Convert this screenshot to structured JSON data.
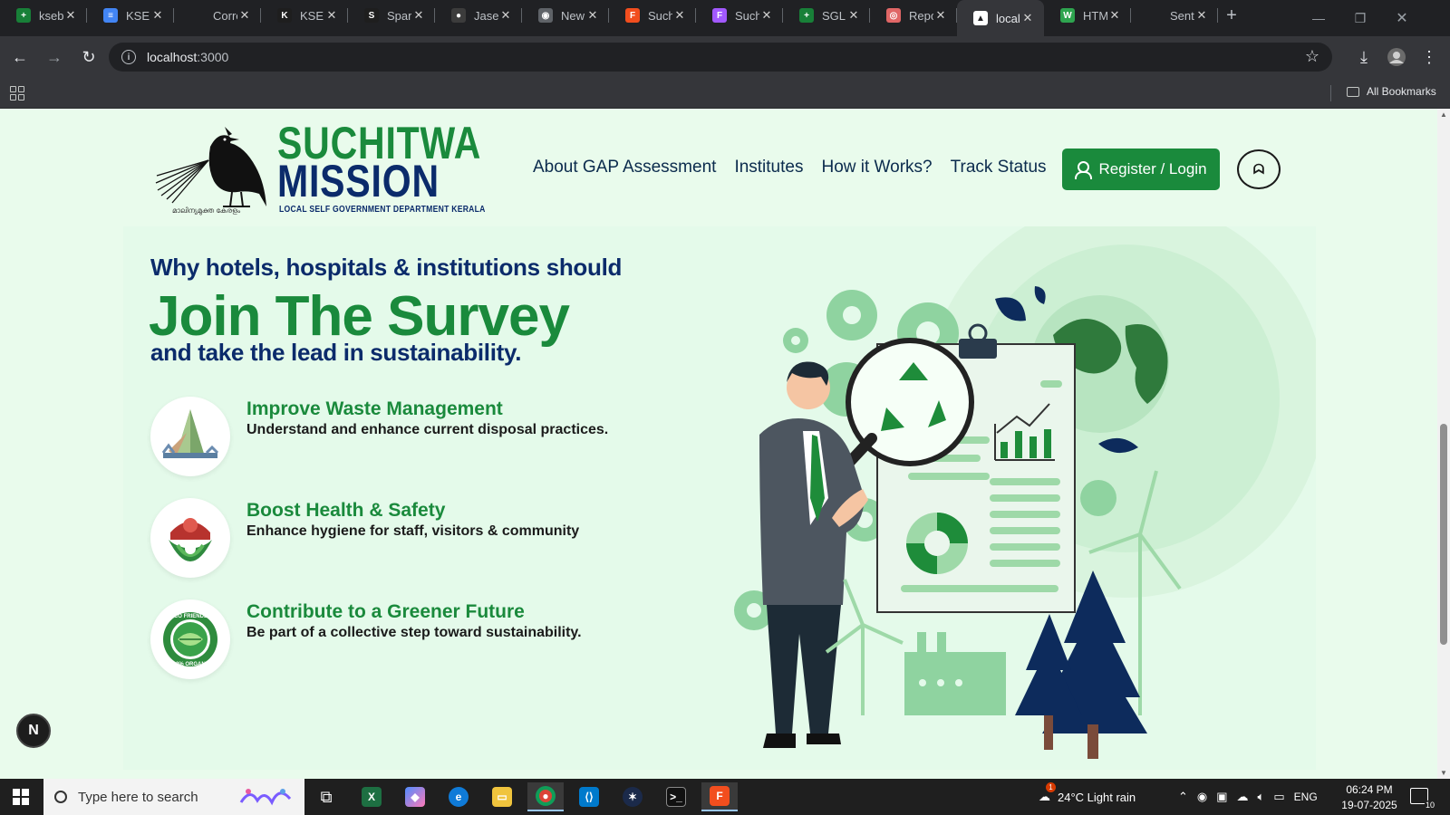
{
  "browser": {
    "tabs": [
      {
        "title": "kseb",
        "color": "#188038",
        "glyph": "+"
      },
      {
        "title": "KSEB",
        "color": "#4285f4",
        "glyph": "≡"
      },
      {
        "title": "Corre",
        "color": "",
        "glyph": ""
      },
      {
        "title": "KSEB",
        "color": "#1e1e1e",
        "glyph": "K"
      },
      {
        "title": "Spare",
        "color": "#1e1e1e",
        "glyph": "S"
      },
      {
        "title": "Jasee",
        "color": "#3c3c3c",
        "glyph": "●"
      },
      {
        "title": "New",
        "color": "#5f6368",
        "glyph": "◉"
      },
      {
        "title": "Such",
        "color": "#f24e1e",
        "glyph": "F"
      },
      {
        "title": "Such",
        "color": "#a259ff",
        "glyph": "F"
      },
      {
        "title": "SGLR",
        "color": "#188038",
        "glyph": "+"
      },
      {
        "title": "Repo",
        "color": "#e06666",
        "glyph": "◎"
      },
      {
        "title": "local",
        "color": "#ffffff",
        "glyph": "▲",
        "active": true
      },
      {
        "title": "HTM",
        "color": "#2ea44f",
        "glyph": "W"
      },
      {
        "title": "Sent",
        "color": "",
        "glyph": ""
      }
    ],
    "url_host": "localhost",
    "url_port": ":3000",
    "all_bookmarks": "All Bookmarks"
  },
  "site": {
    "logo": {
      "line1": "SUCHITWA",
      "line2": "MISSION",
      "subtitle": "LOCAL SELF GOVERNMENT DEPARTMENT KERALA",
      "malayalam": "മാലിന്യമുക്ത കേരളം"
    },
    "nav": [
      "About GAP Assessment",
      "Institutes",
      "How it Works?",
      "Track Status"
    ],
    "register_label": "Register / Login",
    "circle_btn": "ᗣ"
  },
  "hero": {
    "pre": "Why hotels, hospitals & institutions should",
    "main": "Join The Survey",
    "post": "and take the lead in sustainability.",
    "features": [
      {
        "title": "Improve Waste Management",
        "desc": "Understand and enhance current disposal practices."
      },
      {
        "title": "Boost Health & Safety",
        "desc": "Enhance hygiene for staff, visitors & community"
      },
      {
        "title": "Contribute to a Greener Future",
        "desc": "Be part of a collective step toward sustainability."
      }
    ],
    "eco_badge_top": "ECO FRIENDLY",
    "eco_badge_bottom": "100% ORGANIC"
  },
  "dev_badge": "N",
  "taskbar": {
    "search_placeholder": "Type here to search",
    "weather": "24°C  Light rain",
    "weather_alert": "1",
    "lang": "ENG",
    "time": "06:24 PM",
    "date": "19-07-2025",
    "notifications": "10"
  },
  "colors": {
    "brand_green": "#1a8a3c",
    "brand_navy": "#0b2b6b",
    "page_bg": "#e9fbec"
  }
}
